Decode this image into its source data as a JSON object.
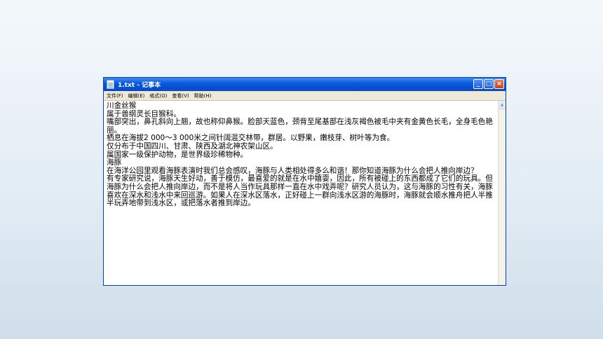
{
  "window": {
    "title": "1.txt - 记事本",
    "controls": {
      "minimize": "_",
      "maximize": "□",
      "close": "×"
    }
  },
  "menu": [
    "文件(F)",
    "编辑(E)",
    "格式(O)",
    "查看(V)",
    "帮助(H)"
  ],
  "content": {
    "lines": [
      "川金丝猴",
      "属于兽纲灵长目猴科。",
      "嘴部突出，鼻孔斜向上翘，故也称仰鼻猴。脸部天蓝色，颈背至尾基部在浅灰褐色被毛中夹有金黄色长毛，全身毛色艳丽。",
      "栖息在海拔2 000～3 000米之间针阔混交林带，群居。以野果，嫩枝芽、树叶等为食。",
      "仅分布于中国四川、甘肃、陕西及湖北神农架山区。",
      "属国家一级保护动物，是世界级珍稀物种。",
      "海豚",
      "在海洋公园里观看海豚表演时我们总会感叹，海豚与人类相处得多么和谐！那你知道海豚为什么会把人推向岸边？",
      "有专家研究说，海豚天生好动，善于模仿，最喜爱的就是在水中嬉耍，因此，所有被碰上的东西都成了它们的玩具。但海豚为什么会把人推向岸边，而不是将人当作玩具那样一直在水中戏弄呢？研究人员认为，这与海豚的习性有关，海豚喜欢在深水和浅水中来回巡游。如果人在深水区落水，正好碰上一群向浅水区游的海豚时，海豚就会顺水推舟把人半推半玩弄地带到浅水区，或把落水者推到岸边。"
    ]
  },
  "scrollbar": {
    "up_arrow": "▲"
  }
}
